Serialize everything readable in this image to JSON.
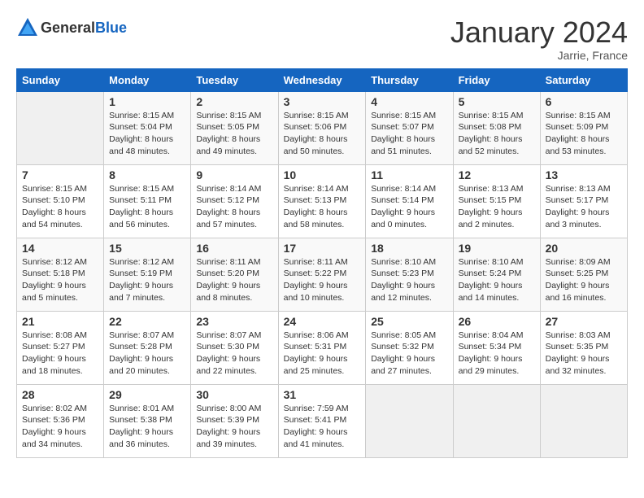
{
  "logo": {
    "text_general": "General",
    "text_blue": "Blue"
  },
  "header": {
    "month": "January 2024",
    "location": "Jarrie, France"
  },
  "weekdays": [
    "Sunday",
    "Monday",
    "Tuesday",
    "Wednesday",
    "Thursday",
    "Friday",
    "Saturday"
  ],
  "weeks": [
    [
      {
        "day": "",
        "sunrise": "",
        "sunset": "",
        "daylight": ""
      },
      {
        "day": "1",
        "sunrise": "Sunrise: 8:15 AM",
        "sunset": "Sunset: 5:04 PM",
        "daylight": "Daylight: 8 hours and 48 minutes."
      },
      {
        "day": "2",
        "sunrise": "Sunrise: 8:15 AM",
        "sunset": "Sunset: 5:05 PM",
        "daylight": "Daylight: 8 hours and 49 minutes."
      },
      {
        "day": "3",
        "sunrise": "Sunrise: 8:15 AM",
        "sunset": "Sunset: 5:06 PM",
        "daylight": "Daylight: 8 hours and 50 minutes."
      },
      {
        "day": "4",
        "sunrise": "Sunrise: 8:15 AM",
        "sunset": "Sunset: 5:07 PM",
        "daylight": "Daylight: 8 hours and 51 minutes."
      },
      {
        "day": "5",
        "sunrise": "Sunrise: 8:15 AM",
        "sunset": "Sunset: 5:08 PM",
        "daylight": "Daylight: 8 hours and 52 minutes."
      },
      {
        "day": "6",
        "sunrise": "Sunrise: 8:15 AM",
        "sunset": "Sunset: 5:09 PM",
        "daylight": "Daylight: 8 hours and 53 minutes."
      }
    ],
    [
      {
        "day": "7",
        "sunrise": "Sunrise: 8:15 AM",
        "sunset": "Sunset: 5:10 PM",
        "daylight": "Daylight: 8 hours and 54 minutes."
      },
      {
        "day": "8",
        "sunrise": "Sunrise: 8:15 AM",
        "sunset": "Sunset: 5:11 PM",
        "daylight": "Daylight: 8 hours and 56 minutes."
      },
      {
        "day": "9",
        "sunrise": "Sunrise: 8:14 AM",
        "sunset": "Sunset: 5:12 PM",
        "daylight": "Daylight: 8 hours and 57 minutes."
      },
      {
        "day": "10",
        "sunrise": "Sunrise: 8:14 AM",
        "sunset": "Sunset: 5:13 PM",
        "daylight": "Daylight: 8 hours and 58 minutes."
      },
      {
        "day": "11",
        "sunrise": "Sunrise: 8:14 AM",
        "sunset": "Sunset: 5:14 PM",
        "daylight": "Daylight: 9 hours and 0 minutes."
      },
      {
        "day": "12",
        "sunrise": "Sunrise: 8:13 AM",
        "sunset": "Sunset: 5:15 PM",
        "daylight": "Daylight: 9 hours and 2 minutes."
      },
      {
        "day": "13",
        "sunrise": "Sunrise: 8:13 AM",
        "sunset": "Sunset: 5:17 PM",
        "daylight": "Daylight: 9 hours and 3 minutes."
      }
    ],
    [
      {
        "day": "14",
        "sunrise": "Sunrise: 8:12 AM",
        "sunset": "Sunset: 5:18 PM",
        "daylight": "Daylight: 9 hours and 5 minutes."
      },
      {
        "day": "15",
        "sunrise": "Sunrise: 8:12 AM",
        "sunset": "Sunset: 5:19 PM",
        "daylight": "Daylight: 9 hours and 7 minutes."
      },
      {
        "day": "16",
        "sunrise": "Sunrise: 8:11 AM",
        "sunset": "Sunset: 5:20 PM",
        "daylight": "Daylight: 9 hours and 8 minutes."
      },
      {
        "day": "17",
        "sunrise": "Sunrise: 8:11 AM",
        "sunset": "Sunset: 5:22 PM",
        "daylight": "Daylight: 9 hours and 10 minutes."
      },
      {
        "day": "18",
        "sunrise": "Sunrise: 8:10 AM",
        "sunset": "Sunset: 5:23 PM",
        "daylight": "Daylight: 9 hours and 12 minutes."
      },
      {
        "day": "19",
        "sunrise": "Sunrise: 8:10 AM",
        "sunset": "Sunset: 5:24 PM",
        "daylight": "Daylight: 9 hours and 14 minutes."
      },
      {
        "day": "20",
        "sunrise": "Sunrise: 8:09 AM",
        "sunset": "Sunset: 5:25 PM",
        "daylight": "Daylight: 9 hours and 16 minutes."
      }
    ],
    [
      {
        "day": "21",
        "sunrise": "Sunrise: 8:08 AM",
        "sunset": "Sunset: 5:27 PM",
        "daylight": "Daylight: 9 hours and 18 minutes."
      },
      {
        "day": "22",
        "sunrise": "Sunrise: 8:07 AM",
        "sunset": "Sunset: 5:28 PM",
        "daylight": "Daylight: 9 hours and 20 minutes."
      },
      {
        "day": "23",
        "sunrise": "Sunrise: 8:07 AM",
        "sunset": "Sunset: 5:30 PM",
        "daylight": "Daylight: 9 hours and 22 minutes."
      },
      {
        "day": "24",
        "sunrise": "Sunrise: 8:06 AM",
        "sunset": "Sunset: 5:31 PM",
        "daylight": "Daylight: 9 hours and 25 minutes."
      },
      {
        "day": "25",
        "sunrise": "Sunrise: 8:05 AM",
        "sunset": "Sunset: 5:32 PM",
        "daylight": "Daylight: 9 hours and 27 minutes."
      },
      {
        "day": "26",
        "sunrise": "Sunrise: 8:04 AM",
        "sunset": "Sunset: 5:34 PM",
        "daylight": "Daylight: 9 hours and 29 minutes."
      },
      {
        "day": "27",
        "sunrise": "Sunrise: 8:03 AM",
        "sunset": "Sunset: 5:35 PM",
        "daylight": "Daylight: 9 hours and 32 minutes."
      }
    ],
    [
      {
        "day": "28",
        "sunrise": "Sunrise: 8:02 AM",
        "sunset": "Sunset: 5:36 PM",
        "daylight": "Daylight: 9 hours and 34 minutes."
      },
      {
        "day": "29",
        "sunrise": "Sunrise: 8:01 AM",
        "sunset": "Sunset: 5:38 PM",
        "daylight": "Daylight: 9 hours and 36 minutes."
      },
      {
        "day": "30",
        "sunrise": "Sunrise: 8:00 AM",
        "sunset": "Sunset: 5:39 PM",
        "daylight": "Daylight: 9 hours and 39 minutes."
      },
      {
        "day": "31",
        "sunrise": "Sunrise: 7:59 AM",
        "sunset": "Sunset: 5:41 PM",
        "daylight": "Daylight: 9 hours and 41 minutes."
      },
      {
        "day": "",
        "sunrise": "",
        "sunset": "",
        "daylight": ""
      },
      {
        "day": "",
        "sunrise": "",
        "sunset": "",
        "daylight": ""
      },
      {
        "day": "",
        "sunrise": "",
        "sunset": "",
        "daylight": ""
      }
    ]
  ]
}
